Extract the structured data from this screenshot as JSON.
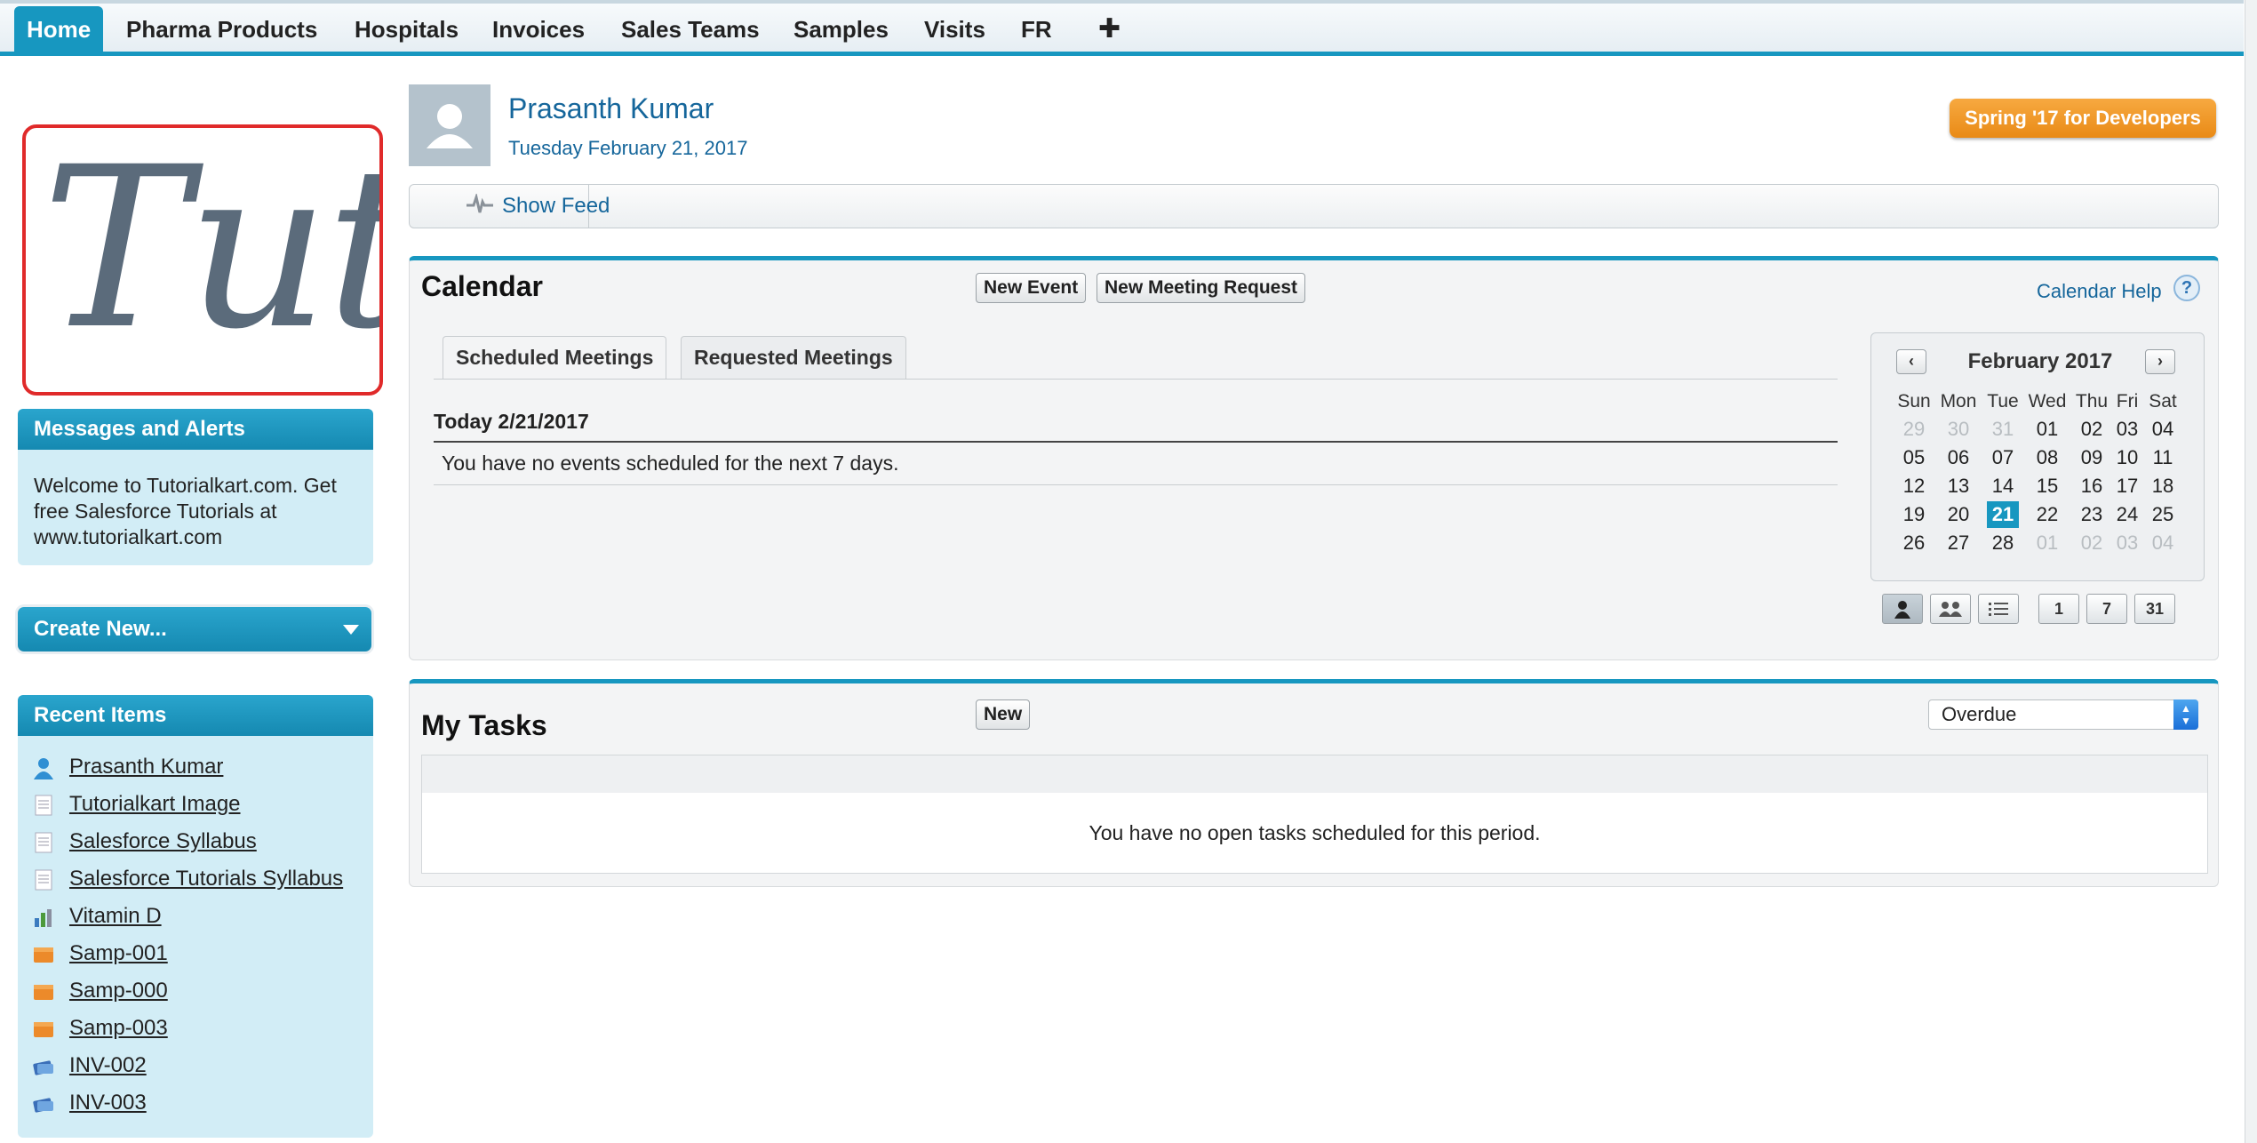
{
  "nav": {
    "tabs": [
      "Home",
      "Pharma Products",
      "Hospitals",
      "Invoices",
      "Sales Teams",
      "Samples",
      "Visits",
      "FR"
    ],
    "add_icon": "plus-icon",
    "active": "Home"
  },
  "sidebar": {
    "logo_text": "Tutorialkart",
    "messages": {
      "title": "Messages and Alerts",
      "text": "Welcome to Tutorialkart.com. Get free Salesforce Tutorials at www.tutorialkart.com"
    },
    "create_new": "Create New...",
    "recent": {
      "title": "Recent Items",
      "items": [
        {
          "label": "Prasanth Kumar",
          "icon": "person-icon"
        },
        {
          "label": "Tutorialkart Image",
          "icon": "document-icon"
        },
        {
          "label": "Salesforce Syllabus",
          "icon": "document-icon"
        },
        {
          "label": "Salesforce Tutorials Syllabus",
          "icon": "document-icon"
        },
        {
          "label": "Vitamin D",
          "icon": "product-chart-icon"
        },
        {
          "label": "Samp-001",
          "icon": "sample-icon"
        },
        {
          "label": "Samp-000",
          "icon": "sample-icon"
        },
        {
          "label": "Samp-003",
          "icon": "sample-icon"
        },
        {
          "label": "INV-002",
          "icon": "invoice-icon"
        },
        {
          "label": "INV-003",
          "icon": "invoice-icon"
        }
      ]
    }
  },
  "header": {
    "user_name": "Prasanth Kumar",
    "date": "Tuesday February 21, 2017",
    "promo": "Spring '17 for Developers",
    "show_feed": "Show Feed"
  },
  "calendar": {
    "title": "Calendar",
    "new_event": "New Event",
    "new_meeting": "New Meeting Request",
    "help": "Calendar Help",
    "tabs": [
      "Scheduled Meetings",
      "Requested Meetings"
    ],
    "today_label": "Today 2/21/2017",
    "no_events": "You have no events scheduled for the next 7 days.",
    "mini": {
      "month": "February 2017",
      "prev": "‹",
      "next": "›",
      "weekdays": [
        "Sun",
        "Mon",
        "Tue",
        "Wed",
        "Thu",
        "Fri",
        "Sat"
      ],
      "weeks": [
        [
          "29",
          "30",
          "31",
          "01",
          "02",
          "03",
          "04"
        ],
        [
          "05",
          "06",
          "07",
          "08",
          "09",
          "10",
          "11"
        ],
        [
          "12",
          "13",
          "14",
          "15",
          "16",
          "17",
          "18"
        ],
        [
          "19",
          "20",
          "21",
          "22",
          "23",
          "24",
          "25"
        ],
        [
          "26",
          "27",
          "28",
          "01",
          "02",
          "03",
          "04"
        ]
      ],
      "today": "21",
      "views": [
        "1",
        "7",
        "31"
      ]
    }
  },
  "tasks": {
    "title": "My Tasks",
    "new_btn": "New",
    "filter": "Overdue",
    "empty": "You have no open tasks scheduled for this period."
  },
  "colors": {
    "accent": "#1797c0",
    "link": "#15669b",
    "promo": "#ec8f1b",
    "sidebar_bg": "#d2edf6"
  }
}
